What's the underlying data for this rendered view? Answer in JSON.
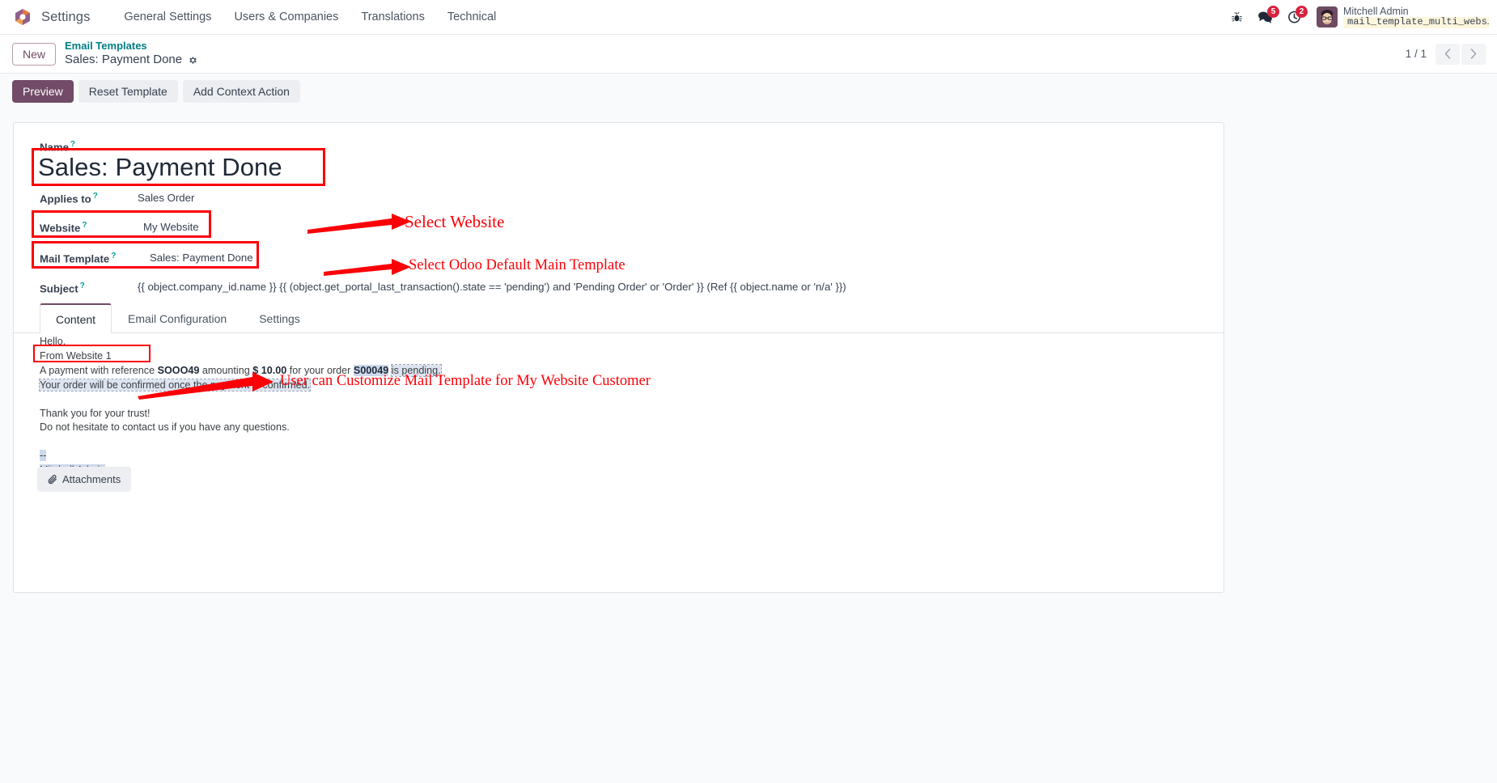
{
  "navbar": {
    "brand": "Settings",
    "menu_items": [
      {
        "label": "General Settings"
      },
      {
        "label": "Users & Companies"
      },
      {
        "label": "Translations"
      },
      {
        "label": "Technical"
      }
    ],
    "messages_badge": "5",
    "activities_badge": "2",
    "user_name": "Mitchell Admin",
    "database_name": "mail_template_multi_webs…"
  },
  "control_panel": {
    "new_button": "New",
    "breadcrumb_parent": "Email Templates",
    "breadcrumb_current": "Sales: Payment Done",
    "pager_count": "1 / 1"
  },
  "actionbar": {
    "preview": "Preview",
    "reset_template": "Reset Template",
    "add_context_action": "Add Context Action"
  },
  "form": {
    "name_label": "Name",
    "name_value": "Sales: Payment Done",
    "applies_to_label": "Applies to",
    "applies_to_value": "Sales Order",
    "website_label": "Website",
    "website_value": "My Website",
    "mail_template_label": "Mail Template",
    "mail_template_value": "Sales: Payment Done",
    "subject_label": "Subject",
    "subject_value": "{{ object.company_id.name }} {{ (object.get_portal_last_transaction().state == 'pending') and 'Pending Order' or 'Order' }} (Ref {{ object.name or 'n/a' }})"
  },
  "tabs": [
    {
      "label": "Content",
      "active": true
    },
    {
      "label": "Email Configuration",
      "active": false
    },
    {
      "label": "Settings",
      "active": false
    }
  ],
  "email_body": {
    "greeting": "Hello,",
    "from_website": "From Website 1",
    "payment_line_1": "A payment with reference ",
    "payment_ref": "SOOO49",
    "payment_line_2": " amounting ",
    "payment_amount": "$ 10.00",
    "payment_line_3": " for your order ",
    "order_ref": "S00049",
    "payment_line_4": " ",
    "payment_status": "is pending.",
    "confirm_line": "Your order will be confirmed once the payment is confirmed.",
    "thanks_line": "Thank you for your trust!",
    "contact_line": "Do not hesitate to contact us if you have any questions.",
    "signature_dashes": "--",
    "signature_name": "Mitchell Admin",
    "attachments_button": "Attachments"
  },
  "annotations": [
    {
      "text": "Select Website"
    },
    {
      "text": "Select Odoo Default Main Template"
    },
    {
      "text": "User can Customize Mail Template for My Website Customer"
    }
  ],
  "colors": {
    "primary": "#714b67",
    "link": "#017e84",
    "annotation": "#fb0007",
    "badge": "#d6233e",
    "help": "#00a09d"
  }
}
